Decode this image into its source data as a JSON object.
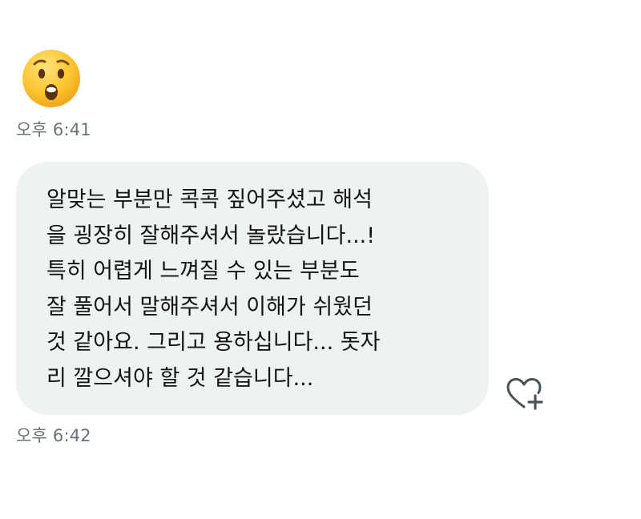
{
  "messages": [
    {
      "type": "emoji",
      "emoji": "hushed-face",
      "time": "오후 6:41"
    },
    {
      "type": "text",
      "lines": [
        "알맞는 부분만 콕콕 짚어주셨고 해석",
        "을 굉장히 잘해주셔서 놀랐습니다...!",
        "특히 어렵게 느껴질 수 있는 부분도",
        "잘 풀어서 말해주셔서 이해가 쉬웠던",
        "것 같아요. 그리고 용하십니다... 돗자",
        "리 깔으셔야 할 것 같습니다..."
      ],
      "time": "오후 6:42"
    }
  ],
  "reaction": {
    "icon": "heart-plus-icon"
  },
  "colors": {
    "bubble": "#eef2f3",
    "timestamp": "#6b7378",
    "emoji_face": "#f9c62b",
    "icon": "#4a5257"
  }
}
